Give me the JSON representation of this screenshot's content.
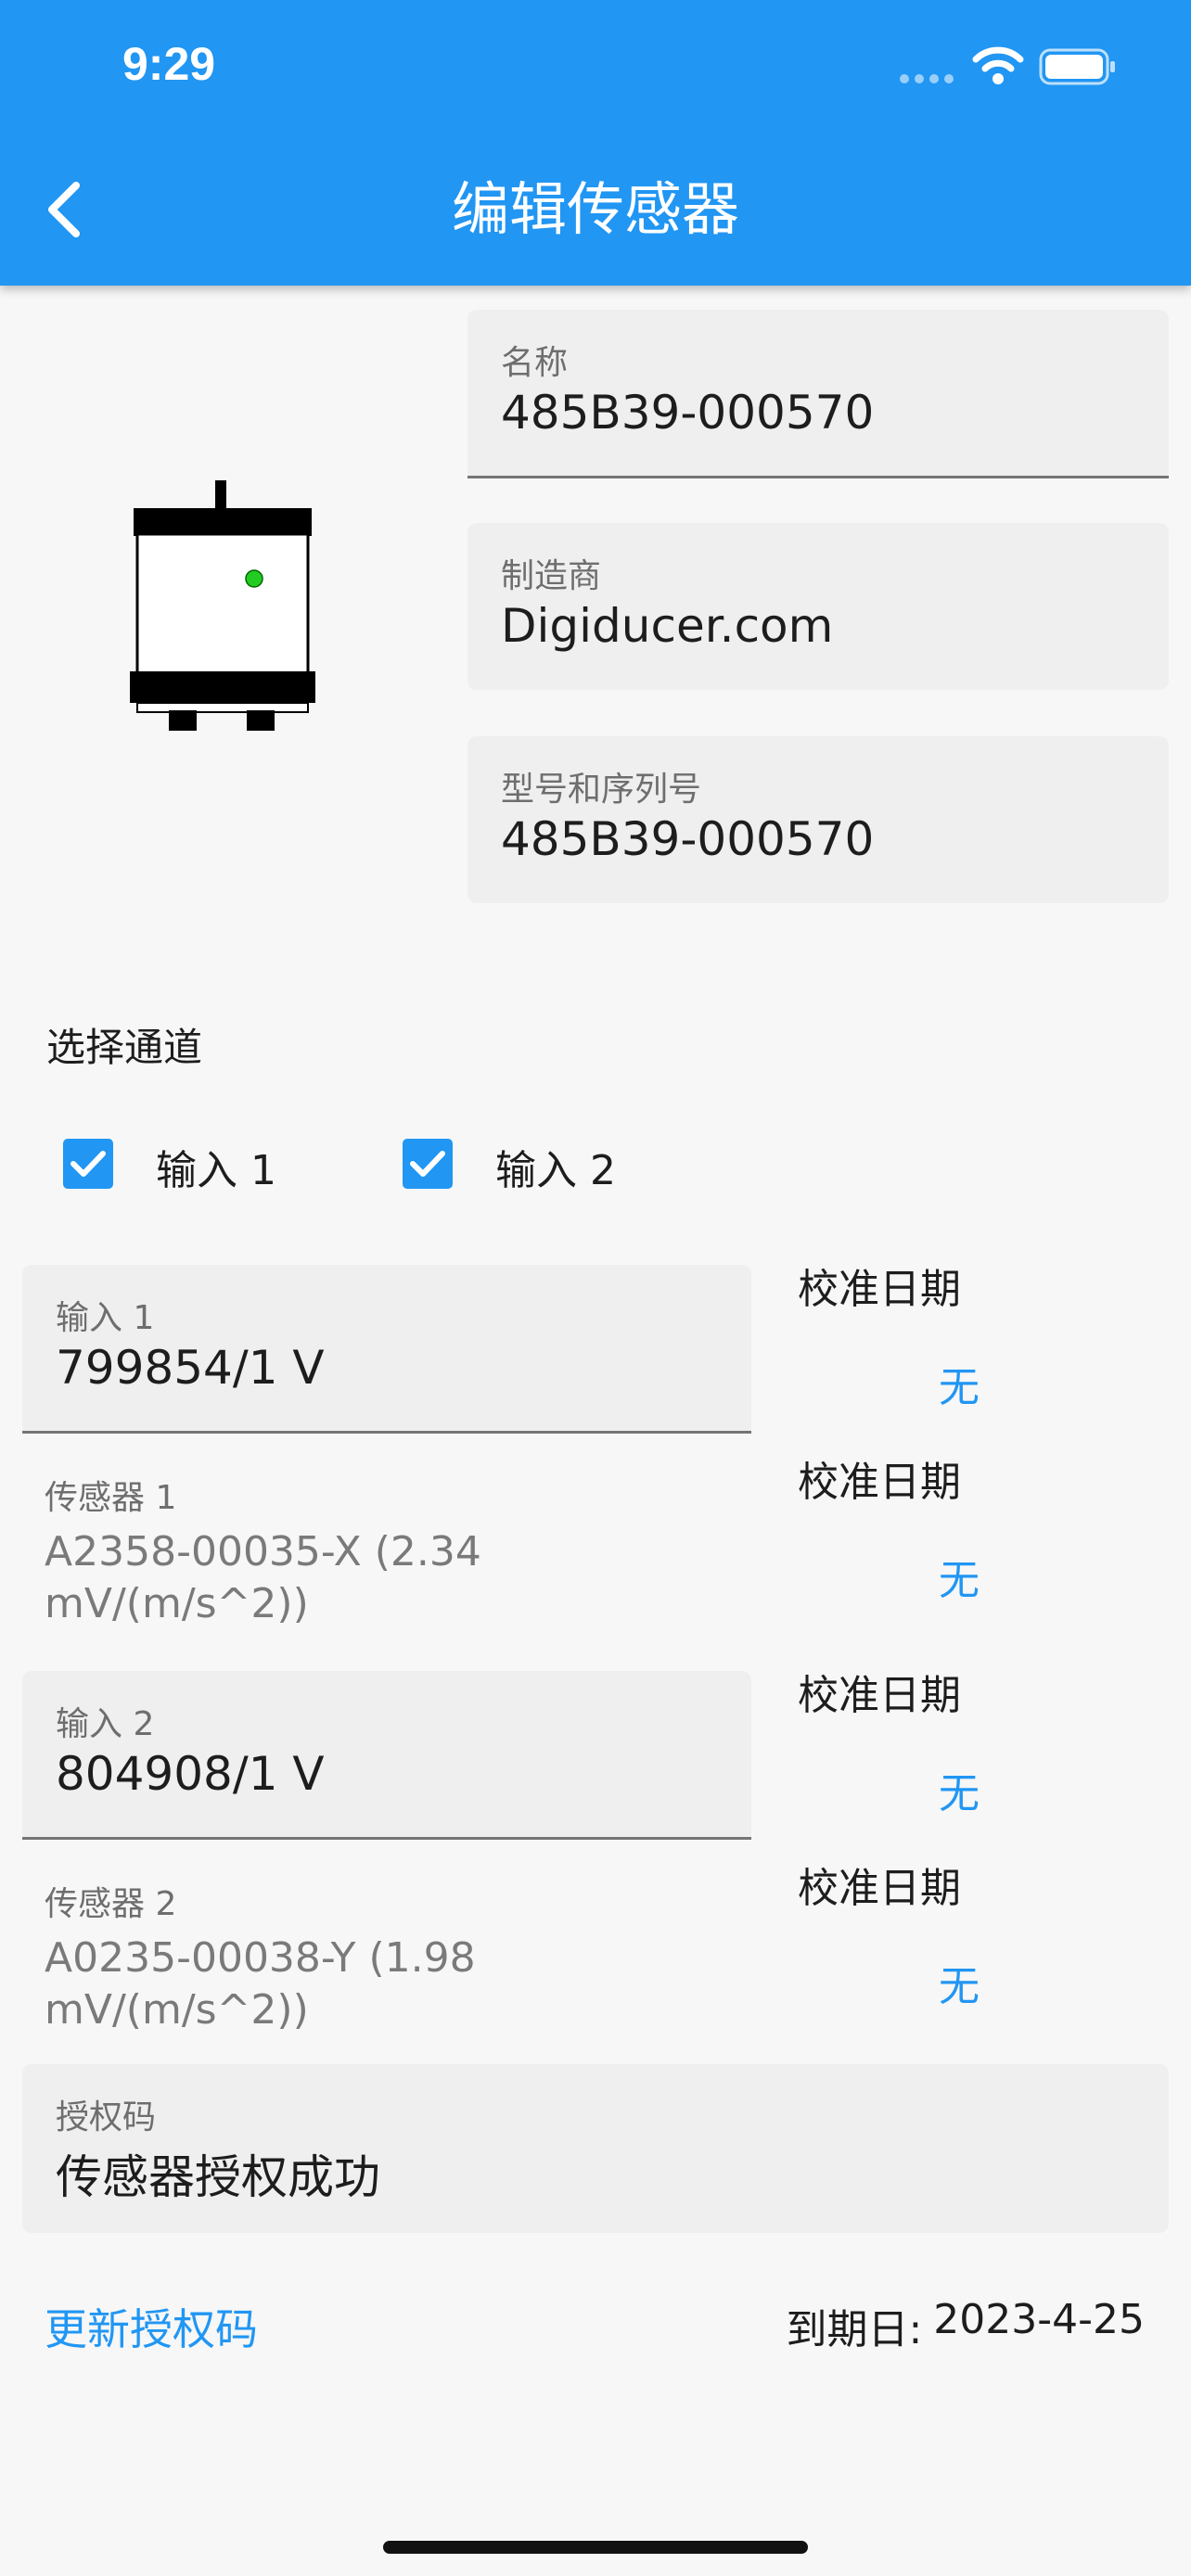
{
  "status_bar": {
    "time": "9:29"
  },
  "app_bar": {
    "title": "编辑传感器",
    "back_icon": "chevron-left-icon"
  },
  "fields": {
    "name": {
      "label": "名称",
      "value": "485B39-000570"
    },
    "manufacturer": {
      "label": "制造商",
      "value": "Digiducer.com"
    },
    "model_serial": {
      "label": "型号和序列号",
      "value": "485B39-000570"
    }
  },
  "channels": {
    "title": "选择通道",
    "options": [
      {
        "label": "输入 1",
        "checked": true
      },
      {
        "label": "输入 2",
        "checked": true
      }
    ]
  },
  "inputs": [
    {
      "label": "输入 1",
      "value": "799854/1 V",
      "calibration_label": "校准日期",
      "calibration_value": "无",
      "sensor_label": "传感器 1",
      "sensor_value": "A2358-00035-X (2.34 mV/(m/s^2))",
      "sensor_calibration_label": "校准日期",
      "sensor_calibration_value": "无"
    },
    {
      "label": "输入 2",
      "value": "804908/1 V",
      "calibration_label": "校准日期",
      "calibration_value": "无",
      "sensor_label": "传感器 2",
      "sensor_value": "A0235-00038-Y (1.98 mV/(m/s^2))",
      "sensor_calibration_label": "校准日期",
      "sensor_calibration_value": "无"
    }
  ],
  "auth": {
    "label": "授权码",
    "value": "传感器授权成功",
    "update_link": "更新授权码",
    "expiry_label": "到期日:",
    "expiry_date": "2023-4-25"
  },
  "colors": {
    "primary": "#2196f3",
    "status_led": "#22cc22"
  }
}
